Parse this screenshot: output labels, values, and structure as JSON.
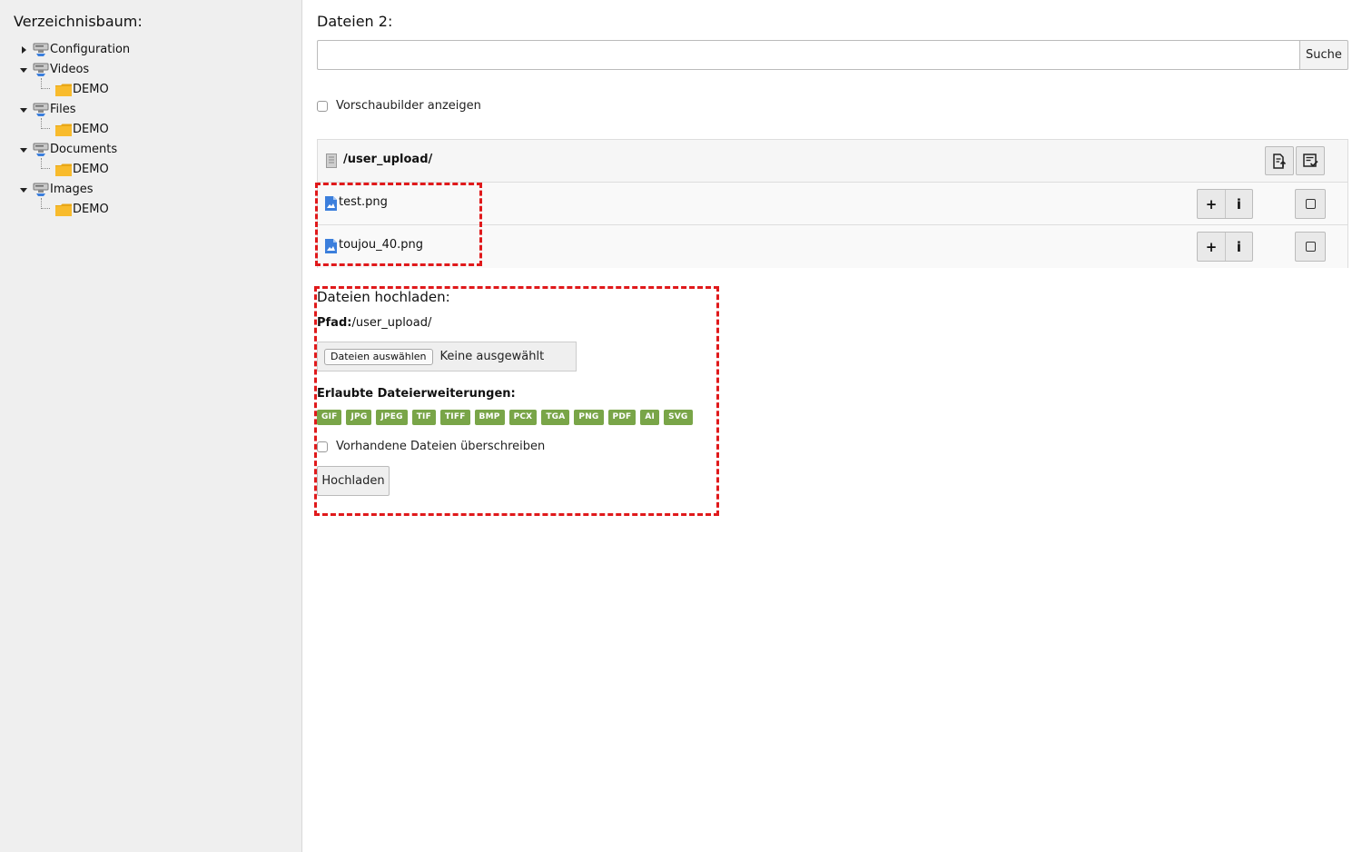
{
  "sidebar": {
    "title": "Verzeichnisbaum:",
    "tree": [
      {
        "label": "Configuration",
        "expanded": false,
        "children": []
      },
      {
        "label": "Videos",
        "expanded": true,
        "children": [
          "DEMO"
        ]
      },
      {
        "label": "Files",
        "expanded": true,
        "children": [
          "DEMO"
        ]
      },
      {
        "label": "Documents",
        "expanded": true,
        "children": [
          "DEMO"
        ]
      },
      {
        "label": "Images",
        "expanded": true,
        "children": [
          "DEMO"
        ]
      }
    ]
  },
  "main": {
    "title": "Dateien 2:",
    "search": {
      "value": "",
      "placeholder": "",
      "button_label": "Suche"
    },
    "thumbnails_label": "Vorschaubilder anzeigen",
    "filelist": {
      "path": "/user_upload/",
      "files": [
        {
          "name": "test.png",
          "add": "+",
          "info": "i"
        },
        {
          "name": "toujou_40.png",
          "add": "+",
          "info": "i"
        }
      ]
    },
    "upload": {
      "title": "Dateien hochladen:",
      "path_label": "Pfad:",
      "path_value": "/user_upload/",
      "choose_button": "Dateien auswählen",
      "choose_status": "Keine ausgewählt",
      "ext_title": "Erlaubte Dateierweiterungen:",
      "extensions": [
        "GIF",
        "JPG",
        "JPEG",
        "TIF",
        "TIFF",
        "BMP",
        "PCX",
        "TGA",
        "PNG",
        "PDF",
        "AI",
        "SVG"
      ],
      "overwrite_label": "Vorhandene Dateien überschreiben",
      "upload_button": "Hochladen"
    }
  },
  "colors": {
    "highlight": "#e0191b",
    "badge": "#79a548",
    "folder": "#f8bb2c",
    "file_icon": "#3c7fdc"
  }
}
